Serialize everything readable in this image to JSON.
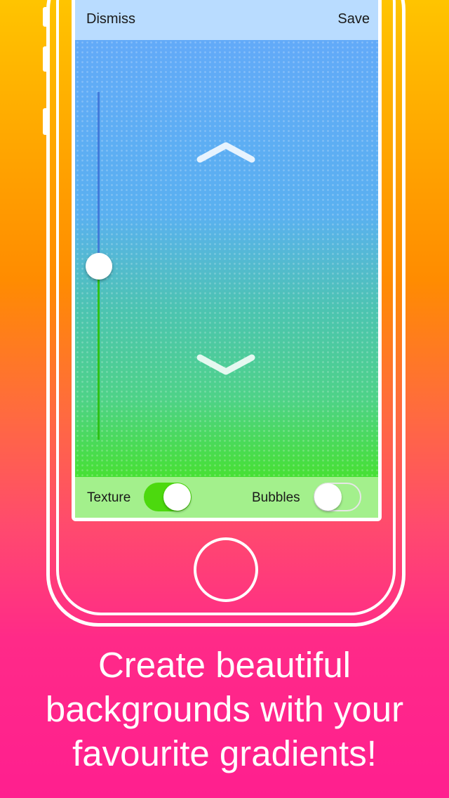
{
  "screen": {
    "topbar": {
      "dismiss_label": "Dismiss",
      "save_label": "Save"
    },
    "gradient": {
      "colors": [
        "#62aaf8",
        "#4cc4b0",
        "#47e034"
      ],
      "slider_value": 0.5
    },
    "controls": {
      "texture_label": "Texture",
      "texture_on": true,
      "bubbles_label": "Bubbles",
      "bubbles_on": false
    }
  },
  "marketing": {
    "line1": "Create beautiful",
    "line2": "backgrounds with your",
    "line3": "favourite gradients!"
  },
  "colors": {
    "accent_toggle": "#4cd90e",
    "background_top": "#ffc400",
    "background_bottom": "#ff1f8f"
  }
}
